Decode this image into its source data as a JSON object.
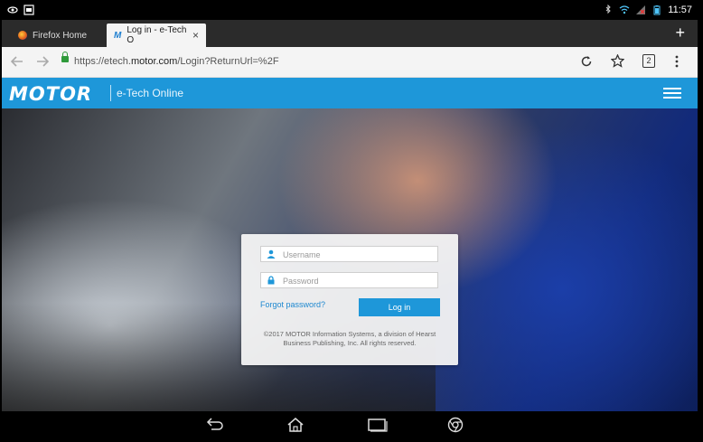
{
  "status_bar": {
    "time": "11:57"
  },
  "tabs": [
    {
      "label": "Firefox Home",
      "favicon": "firefox-icon"
    },
    {
      "label": "Log in - e-Tech O",
      "favicon": "motor-favicon",
      "close": "×"
    }
  ],
  "new_tab_symbol": "+",
  "url_bar": {
    "prefix": "https://etech.",
    "host": "motor.com",
    "suffix": "/Login?ReturnUrl=%2F",
    "tab_count": "2"
  },
  "header": {
    "logo": "MOTOR",
    "subtitle": "e-Tech Online"
  },
  "login": {
    "username_placeholder": "Username",
    "password_placeholder": "Password",
    "forgot_label": "Forgot password?",
    "login_label": "Log in",
    "copyright_line1": "©2017 MOTOR Information Systems, a division of Hearst",
    "copyright_line2": "Business Publishing, Inc. All rights reserved."
  },
  "colors": {
    "brand_blue": "#1e97d9",
    "link_blue": "#1e88d0",
    "lock_green": "#2f9a3a"
  }
}
